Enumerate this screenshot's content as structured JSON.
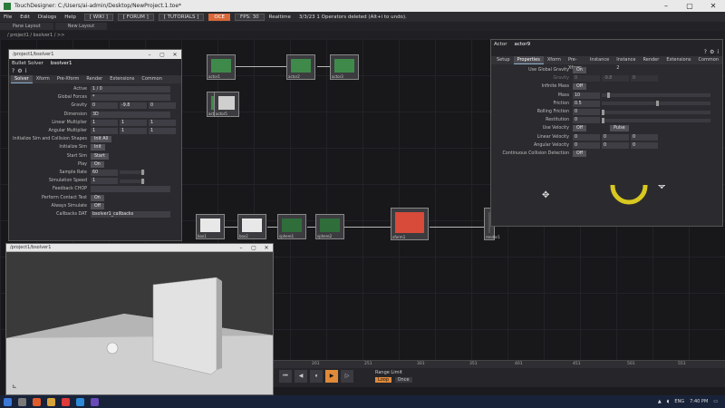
{
  "window": {
    "title": "TouchDesigner: C:/Users/ai-admin/Desktop/NewProject.1.toe*"
  },
  "menubar": {
    "items": [
      "File",
      "Edit",
      "Dialogs",
      "Help"
    ],
    "chips": [
      "[ WIKI ]",
      "[ FORUM ]",
      "[ TUTORIALS ]",
      "OCE",
      "FPS: 30"
    ],
    "realtime": "Realtime",
    "status": "3/3/23 1 Operators deleted (Alt+i to undo)."
  },
  "tabs": [
    "Pane Layout",
    "New Layout"
  ],
  "path": "/ project1 / bsolver1 / >>",
  "network_nodes": [
    {
      "label": "actor1"
    },
    {
      "label": "actor2"
    },
    {
      "label": "actor3"
    },
    {
      "label": "actor4"
    },
    {
      "label": "actor5"
    },
    {
      "label": "box1"
    },
    {
      "label": "box2"
    },
    {
      "label": "sphere1"
    },
    {
      "label": "sphere2"
    },
    {
      "label": "xform1"
    },
    {
      "label": "render1"
    },
    {
      "label": "null1"
    }
  ],
  "bullet_panel": {
    "title": "/project1/bsolver1",
    "op_type": "Bullet Solver",
    "op_name": "bsolver1",
    "tabs": [
      "Solver",
      "Xform",
      "Pre-Xform",
      "Render",
      "Extensions",
      "Common"
    ],
    "active_tab": "Solver",
    "params": [
      {
        "label": "Active",
        "value": "1 / 0"
      },
      {
        "label": "Global Forces",
        "value": "*"
      },
      {
        "label": "Gravity",
        "v1": "0",
        "v2": "-9.8",
        "v3": "0"
      },
      {
        "label": "Dimension",
        "value": "3D"
      },
      {
        "label": "Linear Multiplier",
        "v1": "1",
        "v2": "1",
        "v3": "1"
      },
      {
        "label": "Angular Multiplier",
        "v1": "1",
        "v2": "1",
        "v3": "1"
      },
      {
        "label": "Initialize Sim and Collision Shapes",
        "value": "Init All"
      },
      {
        "label": "Initialize Sim",
        "value": "Init"
      },
      {
        "label": "Start Sim",
        "value": "Start"
      },
      {
        "label": "Play",
        "value": "On"
      },
      {
        "label": "Sample Rate",
        "value": "60"
      },
      {
        "label": "Simulation Speed",
        "value": "1"
      },
      {
        "label": "Feedback CHOP",
        "value": ""
      },
      {
        "label": "Perform Contact Test",
        "value": "On"
      },
      {
        "label": "Always Simulate",
        "value": "Off"
      },
      {
        "label": "Callbacks DAT",
        "value": "bsolver1_callbacks"
      }
    ]
  },
  "actor_panel": {
    "op_type": "Actor",
    "op_name": "actor9",
    "tabs": [
      "Setup",
      "Properties",
      "Xform",
      "Pre-Xform",
      "Instance",
      "Instance 2",
      "Render",
      "Extensions",
      "Common"
    ],
    "active_tab": "Properties",
    "params": [
      {
        "label": "Use Global Gravity",
        "value": "On"
      },
      {
        "label": "Gravity",
        "v1": "0",
        "v2": "-9.8",
        "v3": "0"
      },
      {
        "label": "Infinite Mass",
        "value": "Off"
      },
      {
        "label": "Mass",
        "value": "10"
      },
      {
        "label": "Friction",
        "value": "0.5"
      },
      {
        "label": "Rolling Friction",
        "value": "0"
      },
      {
        "label": "Restitution",
        "value": "0"
      },
      {
        "label": "Use Velocity",
        "value": "Off"
      },
      {
        "label": "Linear Velocity",
        "v1": "0",
        "v2": "0",
        "v3": "0"
      },
      {
        "label": "Angular Velocity",
        "v1": "0",
        "v2": "0",
        "v3": "0"
      },
      {
        "label": "Continuous Collision Detection",
        "value": "Off"
      }
    ],
    "pulse_label": "Pulse"
  },
  "viewer": {
    "title": "/project1/bsolver1"
  },
  "timeline": {
    "ticks": [
      "201",
      "251",
      "301",
      "351",
      "401",
      "451",
      "501",
      "551",
      "601",
      "651",
      "701"
    ],
    "range_label": "Range Limit",
    "loop_label": "Loop",
    "once_label": "Once",
    "frame_value": "1"
  },
  "taskbar": {
    "lang": "ENG",
    "time": "7:40 PM"
  },
  "colors": {
    "accent": "#e08a3a",
    "ring": "#d8c820",
    "bg": "#18181b"
  }
}
